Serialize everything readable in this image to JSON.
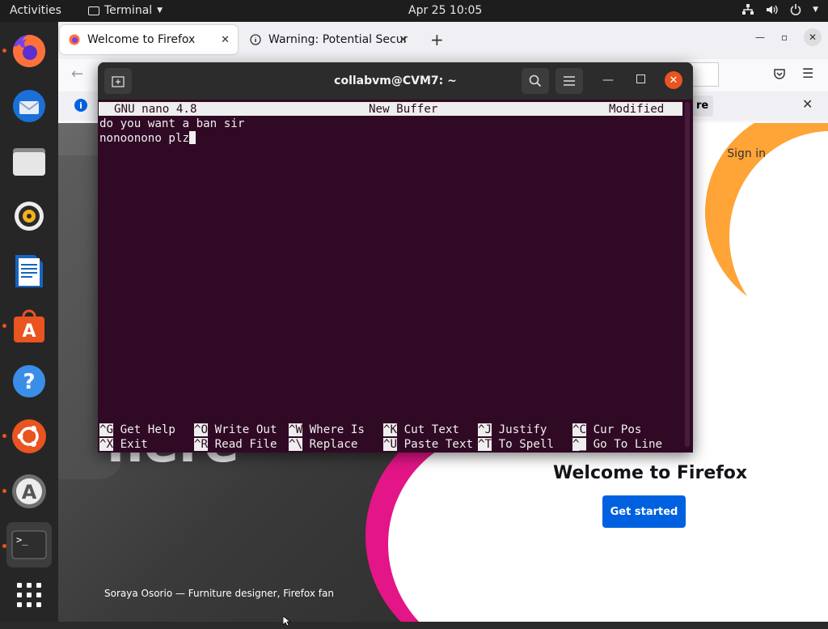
{
  "topbar": {
    "activities": "Activities",
    "app_name": "Terminal",
    "clock": "Apr 25  10:05"
  },
  "dock": {
    "items": [
      "firefox",
      "thunderbird",
      "files",
      "rhythmbox",
      "libreoffice-writer",
      "ubuntu-software",
      "help",
      "ubuntu",
      "software-updater",
      "terminal",
      "show-applications"
    ]
  },
  "browser": {
    "tabs": [
      {
        "label": "Welcome to Firefox"
      },
      {
        "label": "Warning: Potential Securi"
      }
    ],
    "page": {
      "sign_in": "Sign in",
      "welcome_title": "Welcome to Firefox",
      "get_started": "Get started",
      "credit": "Soraya Osorio — Furniture designer, Firefox fan",
      "partial_notice_text": "re",
      "partial_big_text": "nere"
    }
  },
  "terminal": {
    "title": "collabvm@CVM7: ~",
    "nano": {
      "version": "GNU nano 4.8",
      "buffer": "New Buffer",
      "status": "Modified",
      "lines": [
        "do you want a ban sir",
        "nonoonono plz"
      ],
      "shortcuts_row1": [
        {
          "key": "^G",
          "label": "Get Help"
        },
        {
          "key": "^O",
          "label": "Write Out"
        },
        {
          "key": "^W",
          "label": "Where Is"
        },
        {
          "key": "^K",
          "label": "Cut Text"
        },
        {
          "key": "^J",
          "label": "Justify"
        },
        {
          "key": "^C",
          "label": "Cur Pos"
        }
      ],
      "shortcuts_row2": [
        {
          "key": "^X",
          "label": "Exit"
        },
        {
          "key": "^R",
          "label": "Read File"
        },
        {
          "key": "^\\",
          "label": "Replace"
        },
        {
          "key": "^U",
          "label": "Paste Text"
        },
        {
          "key": "^T",
          "label": "To Spell"
        },
        {
          "key": "^_",
          "label": "Go To Line"
        }
      ]
    }
  },
  "colors": {
    "ubuntu_orange": "#e95420",
    "terminal_bg": "#300a24",
    "firefox_blue": "#0061e0"
  }
}
